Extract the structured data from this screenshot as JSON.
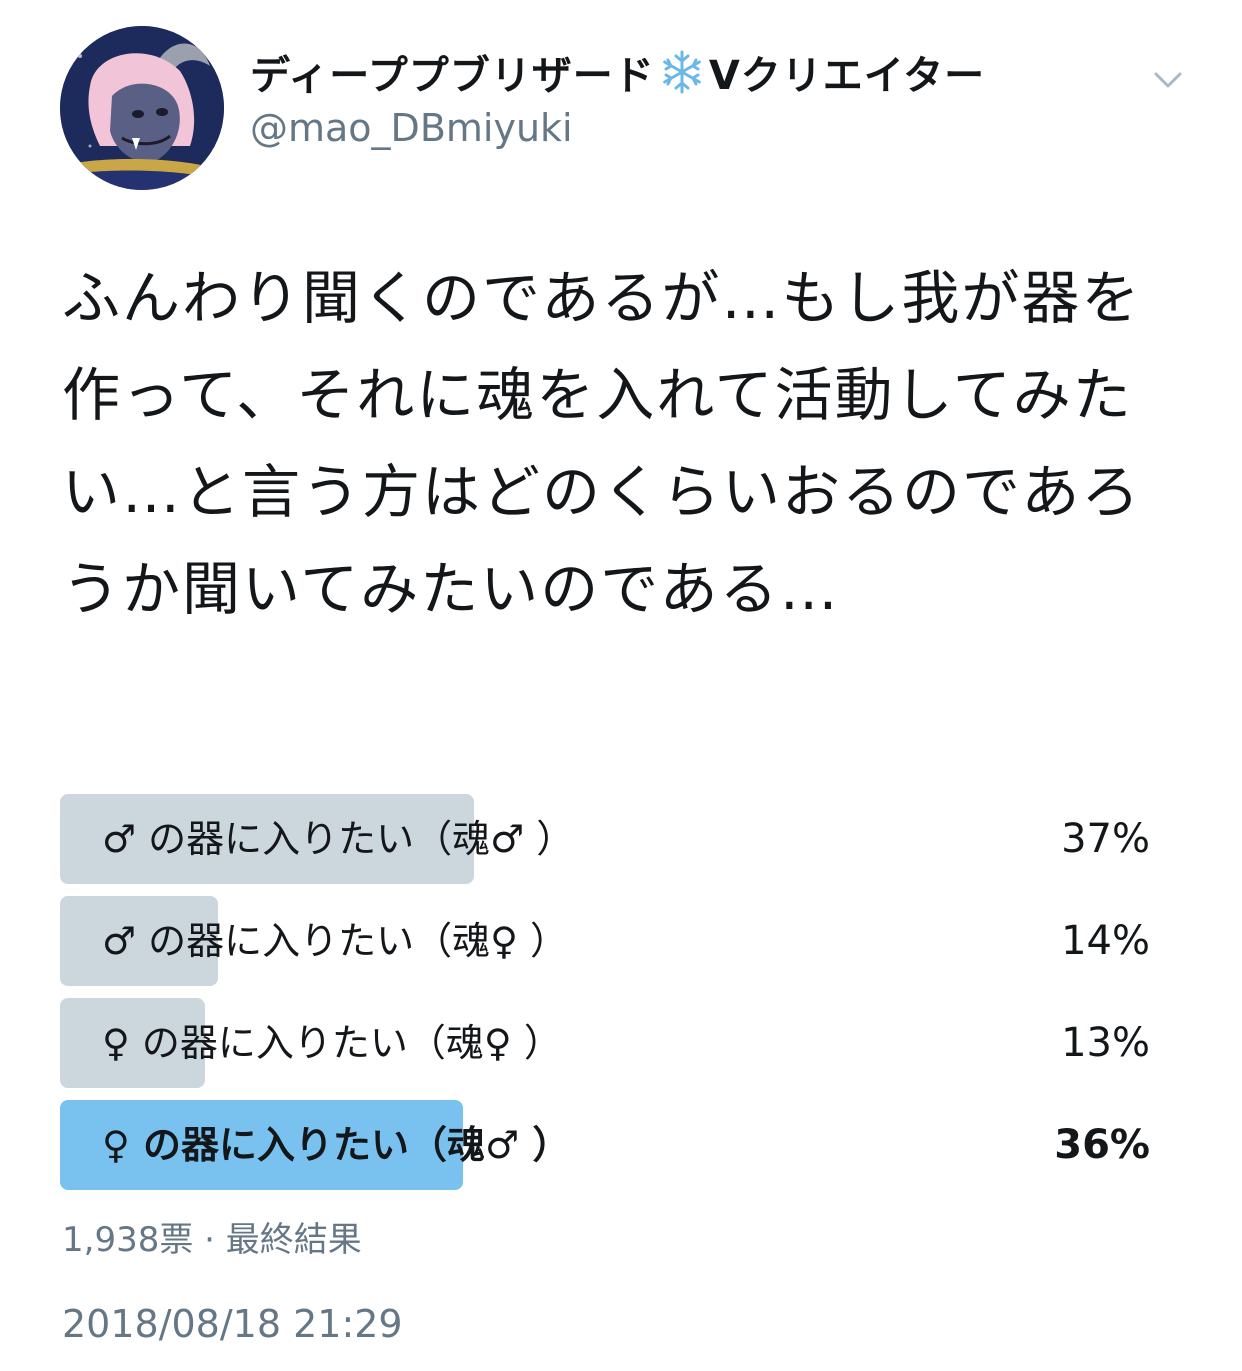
{
  "author": {
    "display_name_part1": "ディーププブリザード",
    "display_name_part2": "Vクリエイター",
    "handle": "@mao_DBmiyuki",
    "name_emoji_icon": "snowflake-icon"
  },
  "tweet": {
    "text": "ふんわり聞くのであるが…もし我が器を作って、それに魂を入れて活動してみたい…と言う方はどのくらいおるのであろうか聞いてみたいのである…"
  },
  "poll": {
    "options": [
      {
        "label": "♂ の器に入りたい（魂♂ ）",
        "percent_label": "37%",
        "percent": 37,
        "bar_fraction": 0.38,
        "winner": false
      },
      {
        "label": "♂ の器に入りたい（魂♀ ）",
        "percent_label": "14%",
        "percent": 14,
        "bar_fraction": 0.145,
        "winner": false
      },
      {
        "label": "♀ の器に入りたい（魂♀ ）",
        "percent_label": "13%",
        "percent": 13,
        "bar_fraction": 0.133,
        "winner": false
      },
      {
        "label": "♀ の器に入りたい（魂♂ ）",
        "percent_label": "36%",
        "percent": 36,
        "bar_fraction": 0.37,
        "winner": true
      }
    ],
    "votes": "1,938票",
    "separator": "·",
    "status": "最終結果"
  },
  "timestamp": "2018/08/18 21:29",
  "colors": {
    "bar": "#ccd6dd",
    "winner_bar": "#79c2f0",
    "secondary_text": "#657786",
    "primary_text": "#14171a"
  }
}
